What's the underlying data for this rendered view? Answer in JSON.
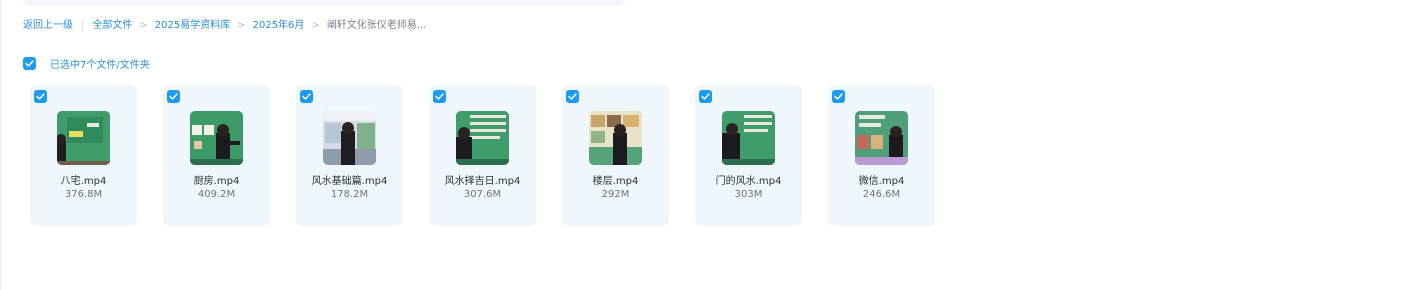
{
  "breadcrumb": {
    "back": "返回上一级",
    "separator_bar": "|",
    "separator": ">",
    "items": [
      "全部文件",
      "2025易学资料库",
      "2025年6月",
      "阐轩文化张仪老师易..."
    ]
  },
  "selection": {
    "label": "已选中7个文件/文件夹",
    "checked": true
  },
  "colors": {
    "accent": "#1d9bf0",
    "card_bg": "#eff7fd",
    "link": "#2a8fd6"
  },
  "files": [
    {
      "name": "八宅.mp4",
      "size": "376.8M",
      "checked": true,
      "icon": "video-thumbnail"
    },
    {
      "name": "厨房.mp4",
      "size": "409.2M",
      "checked": true,
      "icon": "video-thumbnail"
    },
    {
      "name": "风水基础篇.mp4",
      "size": "178.2M",
      "checked": true,
      "icon": "video-thumbnail"
    },
    {
      "name": "风水择吉日.mp4",
      "size": "307.6M",
      "checked": true,
      "icon": "video-thumbnail"
    },
    {
      "name": "楼层.mp4",
      "size": "292M",
      "checked": true,
      "icon": "video-thumbnail"
    },
    {
      "name": "门的风水.mp4",
      "size": "303M",
      "checked": true,
      "icon": "video-thumbnail"
    },
    {
      "name": "微信.mp4",
      "size": "246.6M",
      "checked": true,
      "icon": "video-thumbnail"
    }
  ]
}
